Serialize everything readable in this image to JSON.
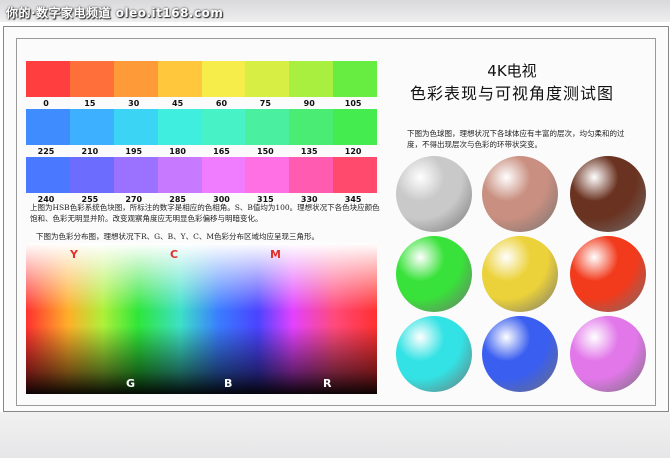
{
  "watermark": "你的·数字家电频道 oleo.it168.com",
  "title_line1": "4K电视",
  "title_line2": "色彩表现与可视角度测试图",
  "hue_rows": [
    {
      "ticks": [
        "0",
        "15",
        "30",
        "45",
        "60",
        "75",
        "90",
        "105"
      ],
      "colors": [
        "#ff3f3f",
        "#ff6f3a",
        "#ff9a38",
        "#ffc73c",
        "#f6ec4a",
        "#d7ef45",
        "#a9ef40",
        "#67ec41"
      ]
    },
    {
      "ticks": [
        "225",
        "210",
        "195",
        "180",
        "165",
        "150",
        "135",
        "120"
      ],
      "colors": [
        "#3f8cff",
        "#3db1ff",
        "#3cd4f5",
        "#40eedf",
        "#46f2c6",
        "#4af0a0",
        "#4aec73",
        "#45ec50"
      ]
    },
    {
      "ticks": [
        "240",
        "255",
        "270",
        "285",
        "300",
        "315",
        "330",
        "345"
      ],
      "colors": [
        "#4a78ff",
        "#6c6cff",
        "#9a72ff",
        "#c77aff",
        "#f07cff",
        "#ff70e4",
        "#ff5bb0",
        "#ff4a6e"
      ]
    }
  ],
  "hsb_desc": "上图为HSB色彩系统色块图，所标注的数字是相应的色相角。S、B值均为100。理想状况下各色块应颜色饱和、色彩无明显并阶。改变观察角度应无明显色彩偏移与明暗变化。",
  "spectrum_desc": "下图为色彩分布图，理想状况下R、G、B、Y、C、M色彩分布区域均应呈现三角形。",
  "spectrum_labels_top": [
    "Y",
    "C",
    "M"
  ],
  "spectrum_labels_bottom": [
    "G",
    "B",
    "R"
  ],
  "ball_desc": "下图为色球图，理想状况下各球体应有丰富的层次，均匀柔和的过度，不得出现层次与色彩的环带状突变。",
  "balls": [
    "#c9c9c9",
    "#c98f80",
    "#6a3220",
    "#39e23a",
    "#ecd23a",
    "#f23a1c",
    "#33e2e4",
    "#3a5ef0",
    "#e277ea"
  ],
  "label_colors": {
    "top": "#e0312d",
    "bottom": "#ffffff"
  }
}
